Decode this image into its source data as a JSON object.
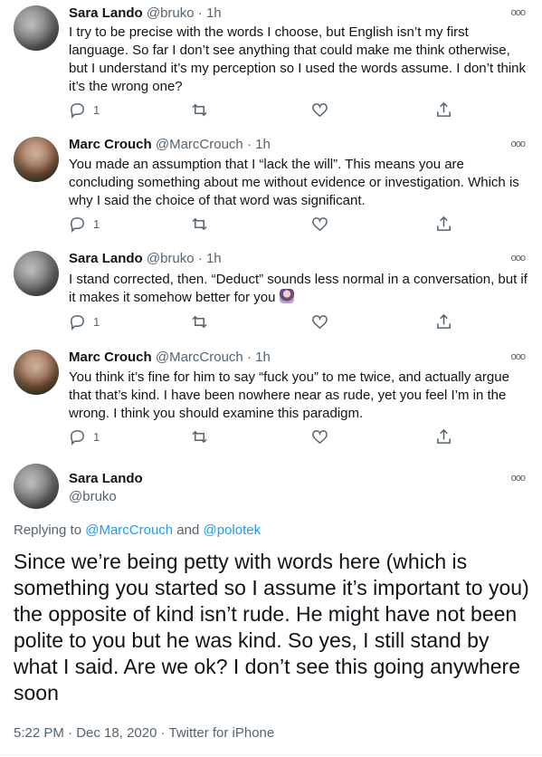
{
  "tweets": [
    {
      "name": "Sara Lando",
      "handle": "@bruko",
      "sep": "·",
      "time": "1h",
      "more": "ooo",
      "text": "I try to be precise with the words I choose, but English isn’t my first language. So far I don’t see anything that could make me think otherwise, but I understand it’s my perception so I used the words assume. I don’t think it’s the wrong one?",
      "reply_count": "1"
    },
    {
      "name": "Marc Crouch",
      "handle": "@MarcCrouch",
      "sep": "·",
      "time": "1h",
      "more": "ooo",
      "text": "You made an assumption that I “lack the will”. This means you are concluding something about me without evidence or investigation. Which is why I said the choice of that word was significant.",
      "reply_count": "1"
    },
    {
      "name": "Sara Lando",
      "handle": "@bruko",
      "sep": "·",
      "time": "1h",
      "more": "ooo",
      "text": "I stand corrected, then. “Deduct” sounds less normal in a conversation, but if it makes it somehow better for you",
      "reply_count": "1"
    },
    {
      "name": "Marc Crouch",
      "handle": "@MarcCrouch",
      "sep": "·",
      "time": "1h",
      "more": "ooo",
      "text": "You think it’s fine for him to say “fuck you” to me twice, and actually  argue that that’s kind. I have been nowhere near as rude, yet you feel I’m in the wrong. I think you should examine this paradigm.",
      "reply_count": "1"
    }
  ],
  "focus": {
    "name": "Sara Lando",
    "handle": "@bruko",
    "more": "ooo",
    "replying_prefix": "Replying to ",
    "replying_user1": "@MarcCrouch",
    "replying_and": " and ",
    "replying_user2": "@polotek",
    "text": "Since we’re being petty with words here (which is something you started so I assume it’s important to you) the opposite of kind isn’t rude. He might have not been polite to you but he was kind. So yes, I still stand by what I said. Are we ok? I don’t see this going anywhere soon",
    "time": "5:22 PM",
    "sep1": " · ",
    "date": "Dec 18, 2020",
    "sep2": " · ",
    "client": "Twitter for iPhone"
  }
}
